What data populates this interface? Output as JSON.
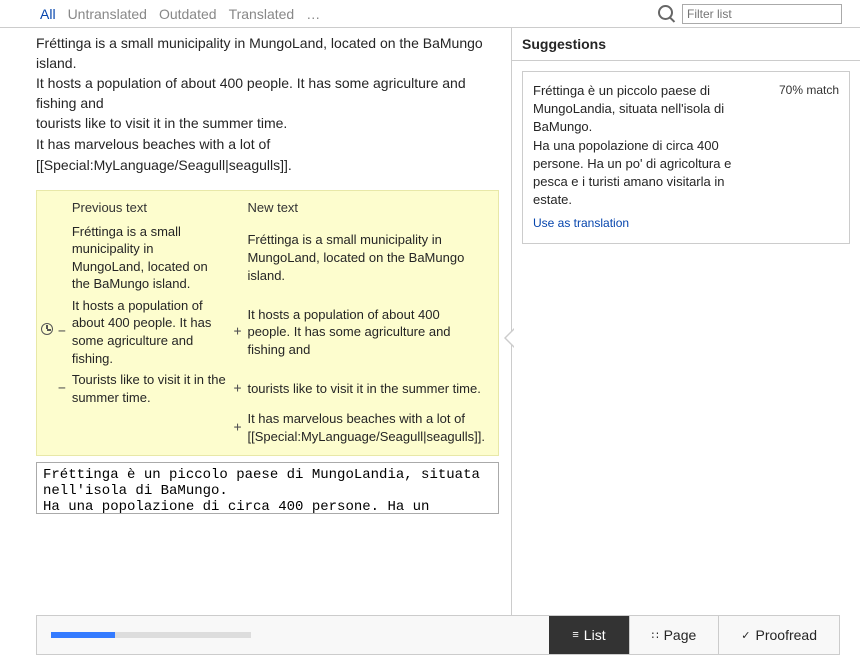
{
  "tabs": {
    "all": "All",
    "untranslated": "Untranslated",
    "outdated": "Outdated",
    "translated": "Translated",
    "more": "…"
  },
  "filter": {
    "placeholder": "Filter list"
  },
  "source": {
    "l1": "Fréttinga is a small municipality in MungoLand, located on the BaMungo island.",
    "l2": "It hosts a population of about 400 people. It has some agriculture and fishing and",
    "l3": "tourists like to visit it in the summer time.",
    "l4": "It has marvelous beaches with a lot of",
    "l5": "[[Special:MyLanguage/Seagull|seagulls]]."
  },
  "diff": {
    "prev_hdr": "Previous text",
    "new_hdr": "New text",
    "rows": [
      {
        "sign_l": "",
        "prev": "Fréttinga is a small municipality in MungoLand, located on the BaMungo island.",
        "sign_r": "",
        "new": "Fréttinga is a small municipality in MungoLand, located on the BaMungo island."
      },
      {
        "sign_l": "−",
        "prev": "It hosts a population of about 400 people. It has some agriculture and fishing.",
        "sign_r": "+",
        "new": "It hosts a population of about 400 people. It has some agriculture and fishing and"
      },
      {
        "sign_l": "−",
        "prev": "Tourists like to visit it in the summer time.",
        "sign_r": "+",
        "new": "tourists like to visit it in the summer time."
      },
      {
        "sign_l": "",
        "prev": "",
        "sign_r": "+",
        "new": "It has marvelous beaches with a lot of [[Special:MyLanguage/Seagull|seagulls]]."
      }
    ]
  },
  "translation": {
    "value": "Fréttinga è un piccolo paese di MungoLandia, situata nell'isola di BaMungo.\nHa una popolazione di circa 400 persone. Ha un"
  },
  "suggestions": {
    "header": "Suggestions",
    "match": "70% match",
    "text": "Fréttinga è un piccolo paese di MungoLandia, situata nell'isola di BaMungo.\nHa una popolazione di circa 400 persone. Ha un po' di agricoltura e pesca e i turisti amano visitarla in estate.",
    "use": "Use as translation"
  },
  "bottom": {
    "list": "List",
    "page": "Page",
    "proofread": "Proofread",
    "progress": 32
  }
}
